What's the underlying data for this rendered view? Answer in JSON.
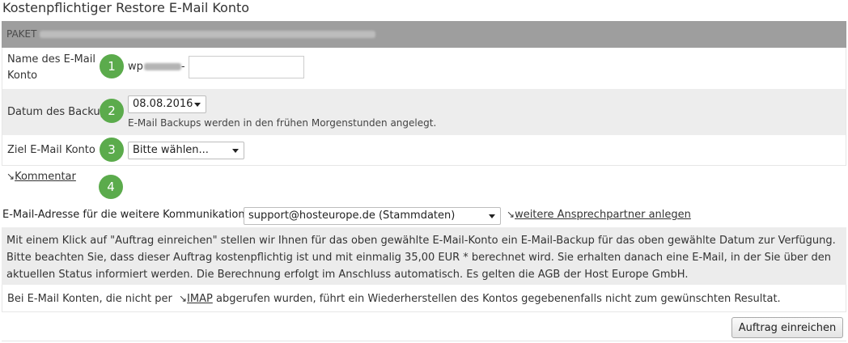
{
  "page": {
    "title": "Kostenpflichtiger Restore E-Mail Konto"
  },
  "paket": {
    "label": "PAKET"
  },
  "name_row": {
    "label": "Name des E-Mail Konto",
    "step": "1",
    "prefix": "wp",
    "separator": "-",
    "input_value": ""
  },
  "backup_row": {
    "label": "Datum des Backup",
    "step": "2",
    "selected_date": "08.08.2016",
    "hint": "E-Mail Backups werden in den frühen Morgenstunden angelegt."
  },
  "target_row": {
    "label": "Ziel E-Mail Konto",
    "step": "3",
    "selected": "Bitte wählen..."
  },
  "comment": {
    "arrow": "↘",
    "link": "Kommentar",
    "step": "4"
  },
  "contact": {
    "label": "E-Mail-Adresse für die weitere Kommunikation:",
    "selected": "support@hosteurope.de (Stammdaten)",
    "arrow": "↘",
    "more_link": "weitere Ansprechpartner anlegen"
  },
  "info": {
    "text": "Mit einem Klick auf \"Auftrag einreichen\" stellen wir Ihnen für das oben gewählte E-Mail-Konto ein E-Mail-Backup für das oben gewählte Datum zur Verfügung. Bitte beachten Sie, dass dieser Auftrag kostenpflichtig ist und mit einmalig 35,00 EUR * berechnet wird. Sie erhalten danach eine E-Mail, in der Sie über den aktuellen Status informiert werden. Die Berechnung erfolgt im Anschluss automatisch. Es gelten die AGB der Host Europe GmbH."
  },
  "note": {
    "before": "Bei E-Mail Konten, die nicht per",
    "arrow": "↘",
    "imap_link": "IMAP",
    "after": "abgerufen wurden, führt ein Wiederherstellen des Kontos gegebenenfalls nicht zum gewünschten Resultat."
  },
  "actions": {
    "submit_label": "Auftrag einreichen"
  },
  "colors": {
    "badge": "#5bab4c",
    "paket_bar": "#9e9e9e",
    "row_shade": "#ededed"
  }
}
